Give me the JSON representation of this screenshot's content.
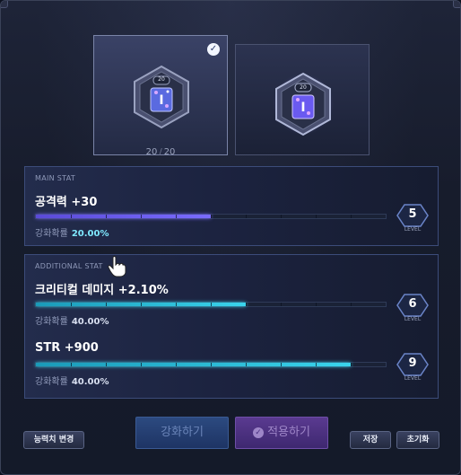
{
  "slot_left": {
    "count_current": "20",
    "count_sep": "/",
    "count_max": "20",
    "gem_badge": "20",
    "selected": true
  },
  "slot_right": {
    "gem_badge": "20"
  },
  "main_stat": {
    "title": "MAIN STAT",
    "stat_label": "공격력 +30",
    "progress": 0.5,
    "prob_label": "강화확률",
    "prob_value": "20.00%",
    "level": "5",
    "level_label": "LEVEL"
  },
  "additional_stat": {
    "title": "ADDITIONAL STAT",
    "stats": [
      {
        "stat_label": "크리티컬 데미지 +2.10%",
        "progress": 0.6,
        "prob_label": "강화확률",
        "prob_value": "40.00%",
        "level": "6",
        "level_label": "LEVEL"
      },
      {
        "stat_label": "STR +900",
        "progress": 0.9,
        "prob_label": "강화확률",
        "prob_value": "40.00%",
        "level": "9",
        "level_label": "LEVEL"
      }
    ]
  },
  "buttons": {
    "change_stat": "능력치 변경",
    "enhance": "강화하기",
    "apply": "적용하기",
    "save": "저장",
    "reset": "초기화"
  },
  "colors": {
    "main_bar": "#7a6cff",
    "additional_bar": "#3ad4ec",
    "enhance_button": "#2c4a80",
    "apply_button": "#5a3a90"
  }
}
